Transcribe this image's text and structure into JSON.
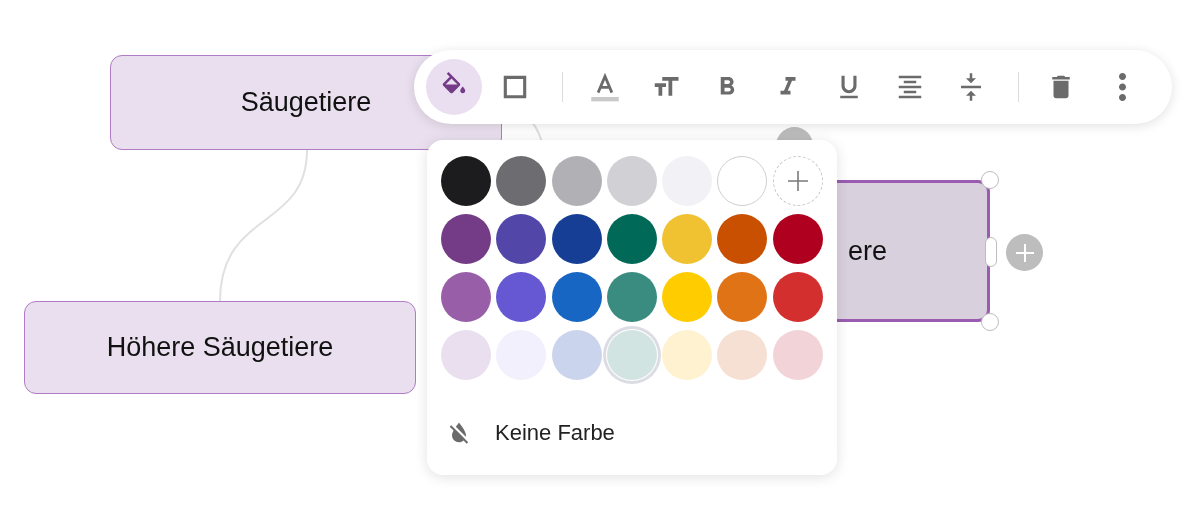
{
  "nodes": [
    {
      "text": "Säugetiere",
      "selected": false
    },
    {
      "text": "Höhere Säugetiere",
      "selected": false
    },
    {
      "text": "ere",
      "selected": true
    }
  ],
  "toolbar": {
    "groups": [
      [
        {
          "kind": "fill",
          "selected": true
        },
        {
          "kind": "border",
          "selected": false
        }
      ],
      [
        {
          "kind": "text-color",
          "selected": false
        },
        {
          "kind": "font-size",
          "selected": false
        },
        {
          "kind": "bold",
          "selected": false
        },
        {
          "kind": "italic",
          "selected": false
        },
        {
          "kind": "underline",
          "selected": false
        },
        {
          "kind": "align",
          "selected": false
        },
        {
          "kind": "spacing",
          "selected": false
        }
      ],
      [
        {
          "kind": "delete",
          "selected": false
        },
        {
          "kind": "more",
          "selected": false
        }
      ]
    ]
  },
  "palette": {
    "rows": [
      [
        {
          "kind": "swatch",
          "color": "#1c1c1e",
          "selected": false
        },
        {
          "kind": "swatch",
          "color": "#6d6c71",
          "selected": false
        },
        {
          "kind": "swatch",
          "color": "#b1b0b5",
          "selected": false
        },
        {
          "kind": "swatch",
          "color": "#d1d0d5",
          "selected": false
        },
        {
          "kind": "swatch",
          "color": "#f2f1f6",
          "selected": false
        },
        {
          "kind": "swatch",
          "color": "#ffffff",
          "selected": false
        },
        {
          "kind": "add"
        }
      ],
      [
        {
          "kind": "swatch",
          "color": "#743b86",
          "selected": false
        },
        {
          "kind": "swatch",
          "color": "#5247a8",
          "selected": false
        },
        {
          "kind": "swatch",
          "color": "#163e94",
          "selected": false
        },
        {
          "kind": "swatch",
          "color": "#006957",
          "selected": false
        },
        {
          "kind": "swatch",
          "color": "#f0c232",
          "selected": false
        },
        {
          "kind": "swatch",
          "color": "#c85000",
          "selected": false
        },
        {
          "kind": "swatch",
          "color": "#b00020",
          "selected": false
        }
      ],
      [
        {
          "kind": "swatch",
          "color": "#985ea8",
          "selected": false
        },
        {
          "kind": "swatch",
          "color": "#6657d2",
          "selected": false
        },
        {
          "kind": "swatch",
          "color": "#1866c3",
          "selected": false
        },
        {
          "kind": "swatch",
          "color": "#3a8c80",
          "selected": false
        },
        {
          "kind": "swatch",
          "color": "#ffcc00",
          "selected": false
        },
        {
          "kind": "swatch",
          "color": "#e07316",
          "selected": false
        },
        {
          "kind": "swatch",
          "color": "#d42f2f",
          "selected": false
        }
      ],
      [
        {
          "kind": "swatch",
          "color": "#eadfef",
          "selected": false
        },
        {
          "kind": "swatch",
          "color": "#f2f0fd",
          "selected": false
        },
        {
          "kind": "swatch",
          "color": "#cad4ec",
          "selected": false
        },
        {
          "kind": "swatch",
          "color": "#d2e4e1",
          "selected": true
        },
        {
          "kind": "swatch",
          "color": "#fff2d1",
          "selected": false
        },
        {
          "kind": "swatch",
          "color": "#f6e0d4",
          "selected": false
        },
        {
          "kind": "swatch",
          "color": "#f2d3d8",
          "selected": false
        }
      ]
    ],
    "no_color": {
      "label": "Keine Farbe"
    }
  }
}
